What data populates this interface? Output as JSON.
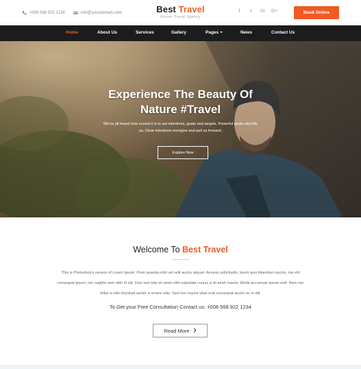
{
  "topbar": {
    "phone": "+008 568 922 1234",
    "email": "info@yourdomain.com",
    "brand_main": "Best ",
    "brand_accent": "Travel",
    "tagline": "Online Travel Agency",
    "social": [
      {
        "icon": "facebook-icon",
        "glyph": "f"
      },
      {
        "icon": "twitter-icon",
        "glyph": "t"
      },
      {
        "icon": "linkedin-icon",
        "glyph": "in"
      },
      {
        "icon": "google-plus-icon",
        "glyph": "G+"
      }
    ],
    "book_label": "Book Online"
  },
  "nav": {
    "items": [
      {
        "label": "Home",
        "active": true
      },
      {
        "label": "About Us"
      },
      {
        "label": "Services"
      },
      {
        "label": "Gallery"
      },
      {
        "label": "Pages"
      },
      {
        "label": "News"
      },
      {
        "label": "Contact Us"
      }
    ]
  },
  "hero": {
    "title_line1": "Experience The Beauty Of",
    "title_line2": "Nature #Travel",
    "subtitle": "We've all heard how crucial it is to set intentions, goals and targets. Powerful goals electrify us. Clear intentions energize and pull us forward.",
    "button_label": "Explore Now"
  },
  "welcome": {
    "title_plain": "Welcome To ",
    "title_accent": "Best Travel",
    "paragraph": "This is Photoshop's version of Lorem Ipsum. Proin gravida nibh vel velit auctor aliquet. Aenean sollicitudin, lorem quis bibendum auctor, nisi elit consequat ipsum, nec sagittis sem nibh id elit. Duis sed odio sit amet nibh vulputate cursus a sit amet mauris. Morbi accumsan ipsum velit. Nam nec tellus a odio tincidunt auctor a ornare odio. Sed non mauris vitae erat consequat auctor eu in elit.",
    "consult_text": "To Get your Free Consultation Contact us: +008 568 922 1234",
    "read_more_label": "Read More"
  },
  "colors": {
    "accent": "#f15a24",
    "nav_bg": "#1c1c1c"
  }
}
